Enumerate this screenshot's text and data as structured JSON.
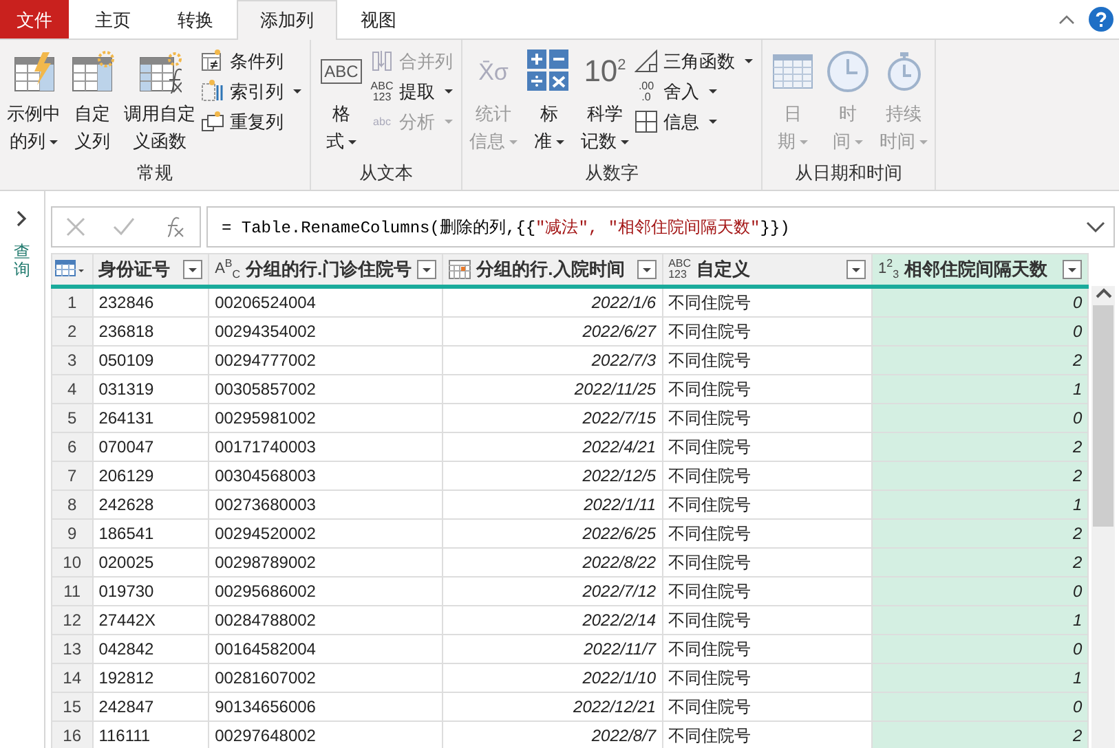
{
  "tabs": [
    {
      "label": "文件",
      "kind": "file",
      "selected": false
    },
    {
      "label": "主页",
      "kind": "tab",
      "selected": false
    },
    {
      "label": "转换",
      "kind": "tab",
      "selected": false
    },
    {
      "label": "添加列",
      "kind": "tab",
      "selected": true
    },
    {
      "label": "视图",
      "kind": "tab",
      "selected": false
    }
  ],
  "ribbon": [
    {
      "label": "常规",
      "items": [
        {
          "kind": "large",
          "lines": [
            "示例中",
            "的列"
          ],
          "dropdown": true,
          "disabled": false
        },
        {
          "kind": "large",
          "lines": [
            "自定",
            "义列"
          ],
          "dropdown": false,
          "disabled": false
        },
        {
          "kind": "large",
          "lines": [
            "调用自定",
            "义函数"
          ],
          "dropdown": false,
          "disabled": false
        },
        {
          "kind": "stack",
          "items": [
            {
              "label": "条件列",
              "dropdown": false,
              "disabled": false
            },
            {
              "label": "索引列",
              "dropdown": true,
              "disabled": false
            },
            {
              "label": "重复列",
              "dropdown": false,
              "disabled": false
            }
          ]
        }
      ]
    },
    {
      "label": "从文本",
      "items": [
        {
          "kind": "large",
          "glyph": "ABC",
          "lines": [
            "格",
            "式"
          ],
          "dropdown": true,
          "disabled": false
        },
        {
          "kind": "stack",
          "items": [
            {
              "label": "合并列",
              "dropdown": false,
              "disabled": true
            },
            {
              "glyph": [
                "ABC",
                "123"
              ],
              "label": "提取",
              "dropdown": true,
              "disabled": false
            },
            {
              "glyph": [
                "abc"
              ],
              "label": "分析",
              "dropdown": true,
              "disabled": true
            }
          ]
        }
      ]
    },
    {
      "label": "从数字",
      "items": [
        {
          "kind": "large",
          "glyph": "X̄σ",
          "lines": [
            "统计",
            "信息"
          ],
          "dropdown": true,
          "disabled": true
        },
        {
          "kind": "large",
          "lines": [
            "标",
            "准"
          ],
          "dropdown": true,
          "disabled": false
        },
        {
          "kind": "large",
          "glyph": "10$^{2}$",
          "lines": [
            "科学",
            "记数"
          ],
          "dropdown": true,
          "disabled": false
        },
        {
          "kind": "stack",
          "items": [
            {
              "label": "三角函数",
              "dropdown": true,
              "disabled": false
            },
            {
              "glyph": [
                ".00",
                ".0"
              ],
              "label": "舍入",
              "dropdown": true,
              "disabled": false
            },
            {
              "label": "信息",
              "dropdown": true,
              "disabled": false
            }
          ]
        }
      ]
    },
    {
      "label": "从日期和时间",
      "items": [
        {
          "kind": "large",
          "lines": [
            "日",
            "期"
          ],
          "dropdown": true,
          "disabled": true
        },
        {
          "kind": "large",
          "lines": [
            "时",
            "间"
          ],
          "dropdown": true,
          "disabled": true
        },
        {
          "kind": "large",
          "lines": [
            "持续",
            "时间"
          ],
          "dropdown": true,
          "disabled": true
        }
      ]
    }
  ],
  "sidebar": {
    "label": "查询"
  },
  "formula": {
    "parts": [
      {
        "kind": "code",
        "text": "= Table.RenameColumns(删除的列,{{"
      },
      {
        "kind": "string",
        "text": "\"减法\", \"相邻住院间隔天数\""
      },
      {
        "kind": "code",
        "text": "}})"
      }
    ]
  },
  "table": {
    "columns": [
      {
        "name": "身份证号",
        "kind": "plain",
        "selected": false
      },
      {
        "name": "分组的行.门诊住院号",
        "kind": "text",
        "glyph": [
          "A$^{B}$$_{C}$"
        ],
        "selected": false
      },
      {
        "name": "分组的行.入院时间",
        "kind": "date",
        "selected": false
      },
      {
        "name": "自定义",
        "kind": "any",
        "glyph": [
          "ABC",
          "123"
        ],
        "selected": false
      },
      {
        "name": "相邻住院间隔天数",
        "kind": "number",
        "glyph": [
          "1$^{2}$$_{3}$"
        ],
        "selected": true
      }
    ],
    "rows": [
      {
        "index": "1",
        "cells": [
          "232846",
          "00206524004",
          "2022/1/6",
          "不同住院号",
          "0"
        ]
      },
      {
        "index": "2",
        "cells": [
          "236818",
          "00294354002",
          "2022/6/27",
          "不同住院号",
          "0"
        ]
      },
      {
        "index": "3",
        "cells": [
          "050109",
          "00294777002",
          "2022/7/3",
          "不同住院号",
          "2"
        ]
      },
      {
        "index": "4",
        "cells": [
          "031319",
          "00305857002",
          "2022/11/25",
          "不同住院号",
          "1"
        ]
      },
      {
        "index": "5",
        "cells": [
          "264131",
          "00295981002",
          "2022/7/15",
          "不同住院号",
          "0"
        ]
      },
      {
        "index": "6",
        "cells": [
          "070047",
          "00171740003",
          "2022/4/21",
          "不同住院号",
          "2"
        ]
      },
      {
        "index": "7",
        "cells": [
          "206129",
          "00304568003",
          "2022/12/5",
          "不同住院号",
          "2"
        ]
      },
      {
        "index": "8",
        "cells": [
          "242628",
          "00273680003",
          "2022/1/11",
          "不同住院号",
          "1"
        ]
      },
      {
        "index": "9",
        "cells": [
          "186541",
          "00294520002",
          "2022/6/25",
          "不同住院号",
          "2"
        ]
      },
      {
        "index": "10",
        "cells": [
          "020025",
          "00298789002",
          "2022/8/22",
          "不同住院号",
          "2"
        ]
      },
      {
        "index": "11",
        "cells": [
          "019730",
          "00295686002",
          "2022/7/12",
          "不同住院号",
          "0"
        ]
      },
      {
        "index": "12",
        "cells": [
          "27442X",
          "00284788002",
          "2022/2/14",
          "不同住院号",
          "1"
        ]
      },
      {
        "index": "13",
        "cells": [
          "042842",
          "00164582004",
          "2022/11/7",
          "不同住院号",
          "0"
        ]
      },
      {
        "index": "14",
        "cells": [
          "192812",
          "00281607002",
          "2022/1/10",
          "不同住院号",
          "1"
        ]
      },
      {
        "index": "15",
        "cells": [
          "242847",
          "90134656006",
          "2022/12/21",
          "不同住院号",
          "0"
        ]
      },
      {
        "index": "16",
        "cells": [
          "116111",
          "00297648002",
          "2022/8/7",
          "不同住院号",
          "2"
        ]
      }
    ]
  }
}
